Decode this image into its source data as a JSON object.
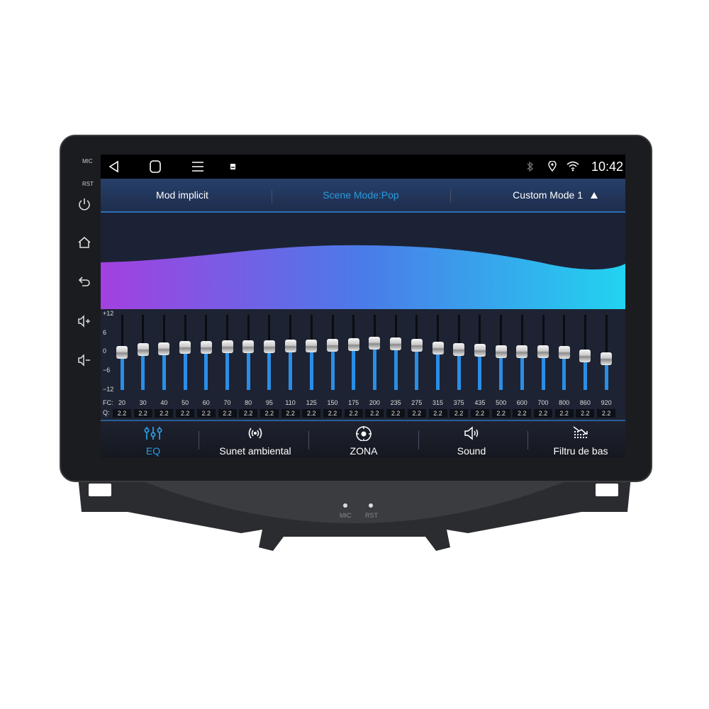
{
  "device": {
    "side_labels": {
      "mic": "MIC",
      "rst": "RST"
    },
    "bottom_labels": {
      "mic": "MIC",
      "rst": "RST"
    },
    "side_buttons": [
      "power-icon",
      "home-icon",
      "back-icon",
      "volume-up-icon",
      "volume-down-icon"
    ]
  },
  "statusbar": {
    "nav": [
      "back-icon",
      "home-icon",
      "menu-icon",
      "gallery-icon"
    ],
    "icons": [
      "bluetooth-icon",
      "location-icon",
      "wifi-icon"
    ],
    "time": "10:42"
  },
  "header": {
    "default_mode": "Mod implicit",
    "scene_mode": "Scene Mode:Pop",
    "custom_mode": "Custom Mode 1",
    "accent": "#2a9be0"
  },
  "eq": {
    "axis": [
      "+12",
      "6",
      "0",
      "−6",
      "−12"
    ],
    "fc_label": "FC:",
    "q_label": "Q:",
    "range": [
      -12,
      12
    ],
    "bands": [
      {
        "fc": "20",
        "q": "2.2",
        "gain": 0
      },
      {
        "fc": "30",
        "q": "2.2",
        "gain": 0.8
      },
      {
        "fc": "40",
        "q": "2.2",
        "gain": 1.2
      },
      {
        "fc": "50",
        "q": "2.2",
        "gain": 1.6
      },
      {
        "fc": "60",
        "q": "2.2",
        "gain": 1.6
      },
      {
        "fc": "70",
        "q": "2.2",
        "gain": 1.8
      },
      {
        "fc": "80",
        "q": "2.2",
        "gain": 1.8
      },
      {
        "fc": "95",
        "q": "2.2",
        "gain": 1.8
      },
      {
        "fc": "110",
        "q": "2.2",
        "gain": 2
      },
      {
        "fc": "125",
        "q": "2.2",
        "gain": 2
      },
      {
        "fc": "150",
        "q": "2.2",
        "gain": 2.2
      },
      {
        "fc": "175",
        "q": "2.2",
        "gain": 2.4
      },
      {
        "fc": "200",
        "q": "2.2",
        "gain": 3
      },
      {
        "fc": "235",
        "q": "2.2",
        "gain": 2.8
      },
      {
        "fc": "275",
        "q": "2.2",
        "gain": 2.2
      },
      {
        "fc": "315",
        "q": "2.2",
        "gain": 1.4
      },
      {
        "fc": "375",
        "q": "2.2",
        "gain": 1
      },
      {
        "fc": "435",
        "q": "2.2",
        "gain": 0.6
      },
      {
        "fc": "500",
        "q": "2.2",
        "gain": 0.2
      },
      {
        "fc": "600",
        "q": "2.2",
        "gain": 0.2
      },
      {
        "fc": "700",
        "q": "2.2",
        "gain": 0.2
      },
      {
        "fc": "800",
        "q": "2.2",
        "gain": 0
      },
      {
        "fc": "860",
        "q": "2.2",
        "gain": -1.2
      },
      {
        "fc": "920",
        "q": "2.2",
        "gain": -2
      }
    ]
  },
  "tabs": [
    {
      "label": "EQ",
      "icon": "equalizer-icon",
      "active": true
    },
    {
      "label": "Sunet ambiental",
      "icon": "surround-icon"
    },
    {
      "label": "ZONA",
      "icon": "target-icon"
    },
    {
      "label": "Sound",
      "icon": "speaker-icon"
    },
    {
      "label": "Filtru de bas",
      "icon": "bass-filter-icon"
    }
  ]
}
